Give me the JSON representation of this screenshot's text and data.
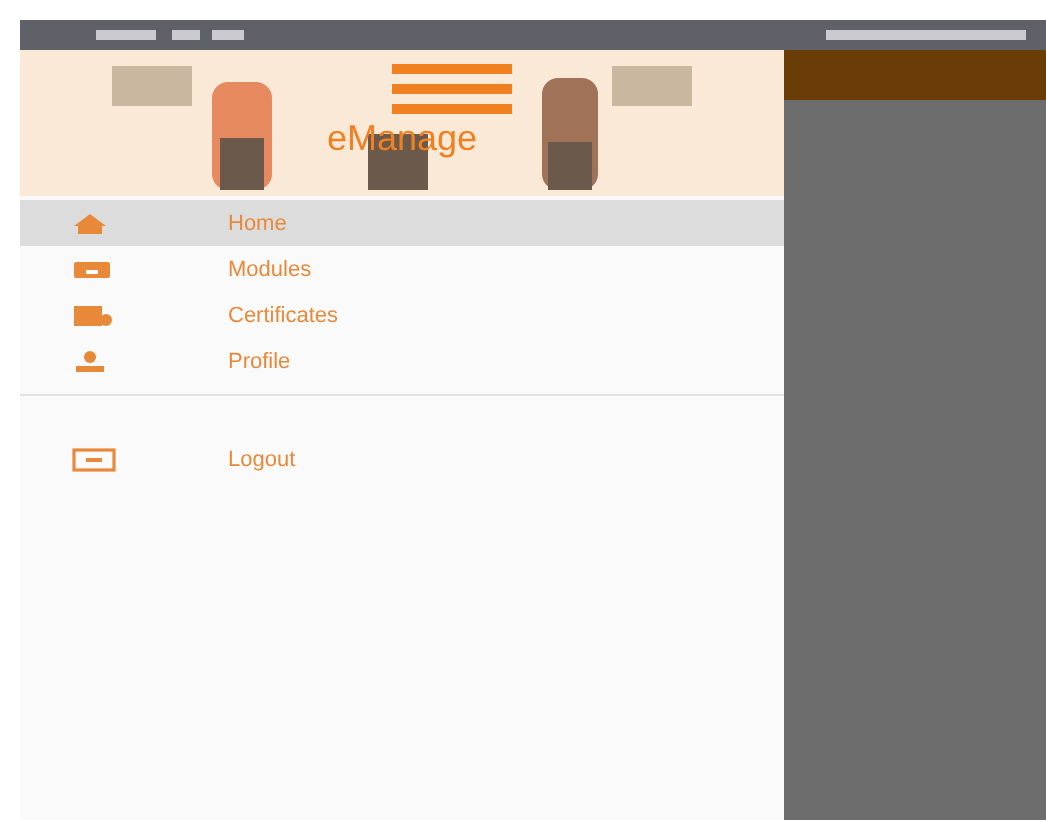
{
  "header": {
    "app_name": "eManage"
  },
  "menu": [
    {
      "kind": "home",
      "label": "Home",
      "selected": true
    },
    {
      "kind": "modules",
      "label": "Modules",
      "selected": false
    },
    {
      "kind": "certificates",
      "label": "Certificates",
      "selected": false
    },
    {
      "kind": "profile",
      "label": "Profile",
      "selected": false
    }
  ],
  "secondary_menu": [
    {
      "kind": "logout",
      "label": "Logout",
      "selected": false
    }
  ]
}
